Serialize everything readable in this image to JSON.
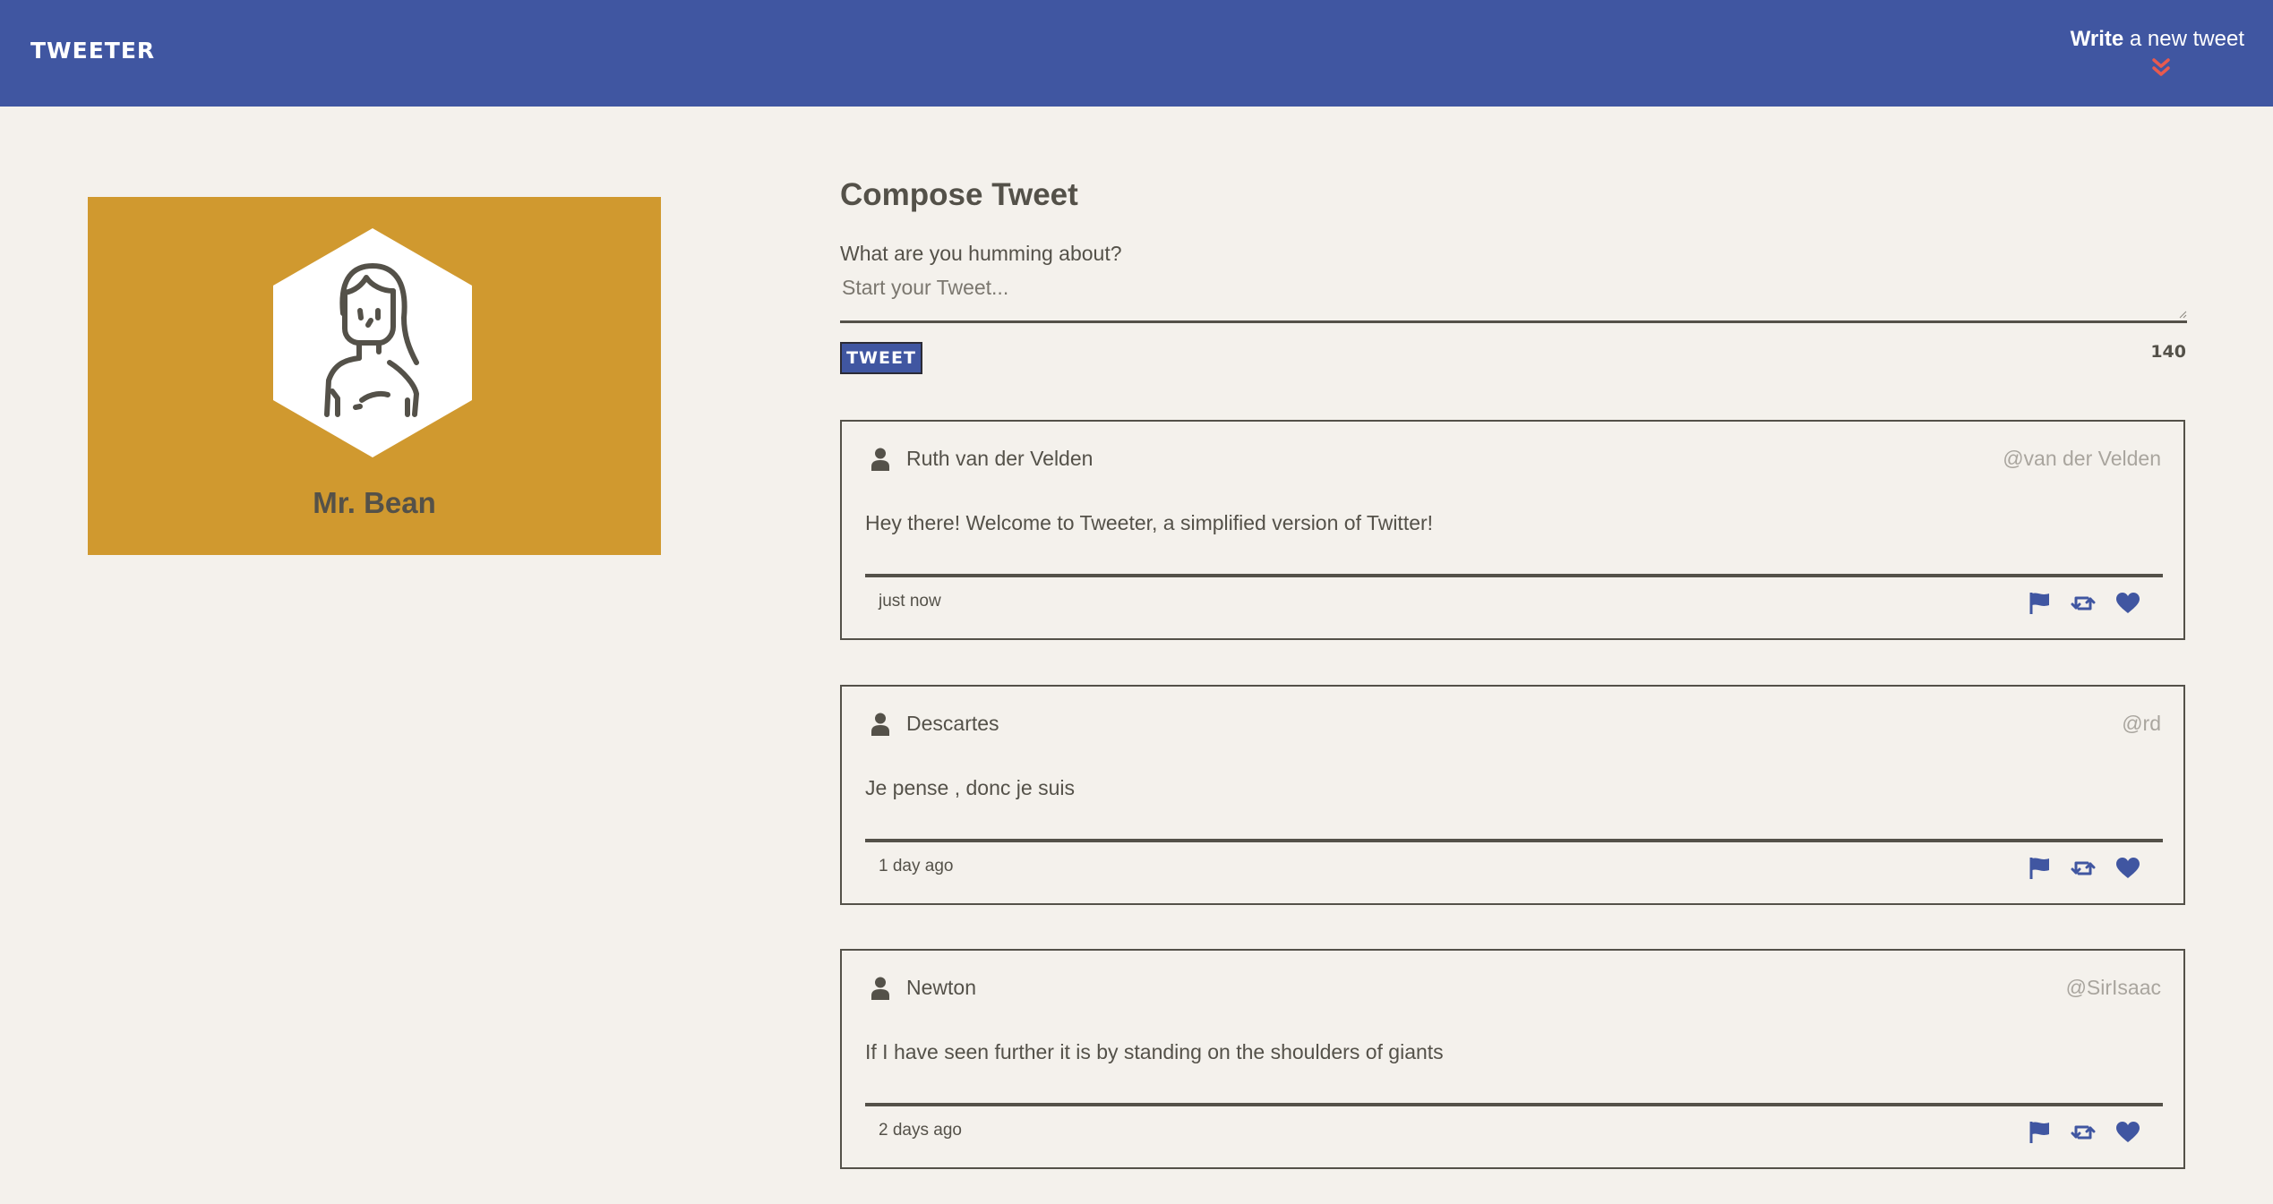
{
  "nav": {
    "brand": "TWEETER",
    "write_bold": "Write",
    "write_rest": " a new tweet",
    "chevron_icon": "double-chevron-down-icon",
    "accent": "#e85a4f"
  },
  "profile": {
    "name": "Mr. Bean",
    "avatar_icon": "woman-avatar-icon",
    "card_color": "#d0992f"
  },
  "compose": {
    "title": "Compose Tweet",
    "label": "What are you humming about?",
    "placeholder": "Start your Tweet...",
    "button_label": "TWEET",
    "counter": "140"
  },
  "tweets": [
    {
      "name": "Ruth van der Velden",
      "handle": "@van der Velden",
      "text": "Hey there! Welcome to Tweeter, a simplified version of Twitter!",
      "time": "just now"
    },
    {
      "name": "Descartes",
      "handle": "@rd",
      "text": "Je pense , donc je suis",
      "time": "1 day ago"
    },
    {
      "name": "Newton",
      "handle": "@SirIsaac",
      "text": "If I have seen further it is by standing on the shoulders of giants",
      "time": "2 days ago"
    }
  ],
  "colors": {
    "primary": "#4056a1",
    "text": "#545149",
    "background": "#f4f1ec",
    "handle": "#a9a59e"
  },
  "tweet_icons": [
    "flag-icon",
    "retweet-icon",
    "heart-icon"
  ]
}
